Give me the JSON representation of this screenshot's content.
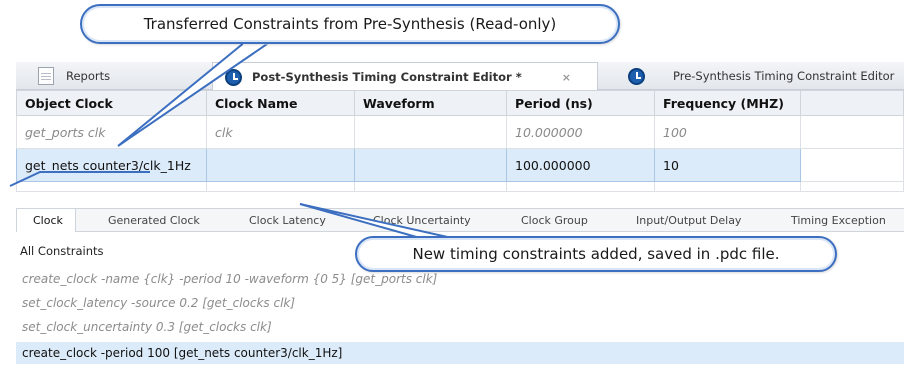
{
  "tabs": [
    {
      "label": "Reports",
      "icon": "report-document-icon",
      "active": false
    },
    {
      "label": "Post-Synthesis Timing Constraint Editor *",
      "icon": "clock-icon",
      "active": true,
      "close": "×"
    },
    {
      "label": "Pre-Synthesis Timing Constraint Editor",
      "icon": "clock-icon",
      "active": false
    }
  ],
  "table": {
    "headers": [
      "Object Clock",
      "Clock Name",
      "Waveform",
      "Period (ns)",
      "Frequency (MHZ)"
    ],
    "rows": [
      [
        "get_ports clk",
        "clk",
        "",
        "10.000000",
        "100"
      ],
      [
        "get_nets counter3/clk_1Hz",
        "",
        "",
        "100.000000",
        "10"
      ]
    ]
  },
  "subtabs": [
    "Clock",
    "Generated Clock",
    "Clock Latency",
    "Clock Uncertainty",
    "Clock Group",
    "Input/Output Delay",
    "Timing Exception"
  ],
  "constraints": {
    "title": "All Constraints",
    "lines": [
      "create_clock -name {clk} -period 10 -waveform {0 5} [get_ports clk]",
      "set_clock_latency -source 0.2 [get_clocks clk]",
      "set_clock_uncertainty 0.3 [get_clocks clk]",
      "create_clock -period 100 [get_nets counter3/clk_1Hz]"
    ]
  },
  "callouts": {
    "top": "Transferred Constraints from Pre-Synthesis (Read-only)",
    "bottom": "New timing constraints added, saved in .pdc file."
  },
  "colors": {
    "accent": "#3d6fc0",
    "selection": "#dcebf9",
    "clock_icon": "#1d5fae"
  }
}
